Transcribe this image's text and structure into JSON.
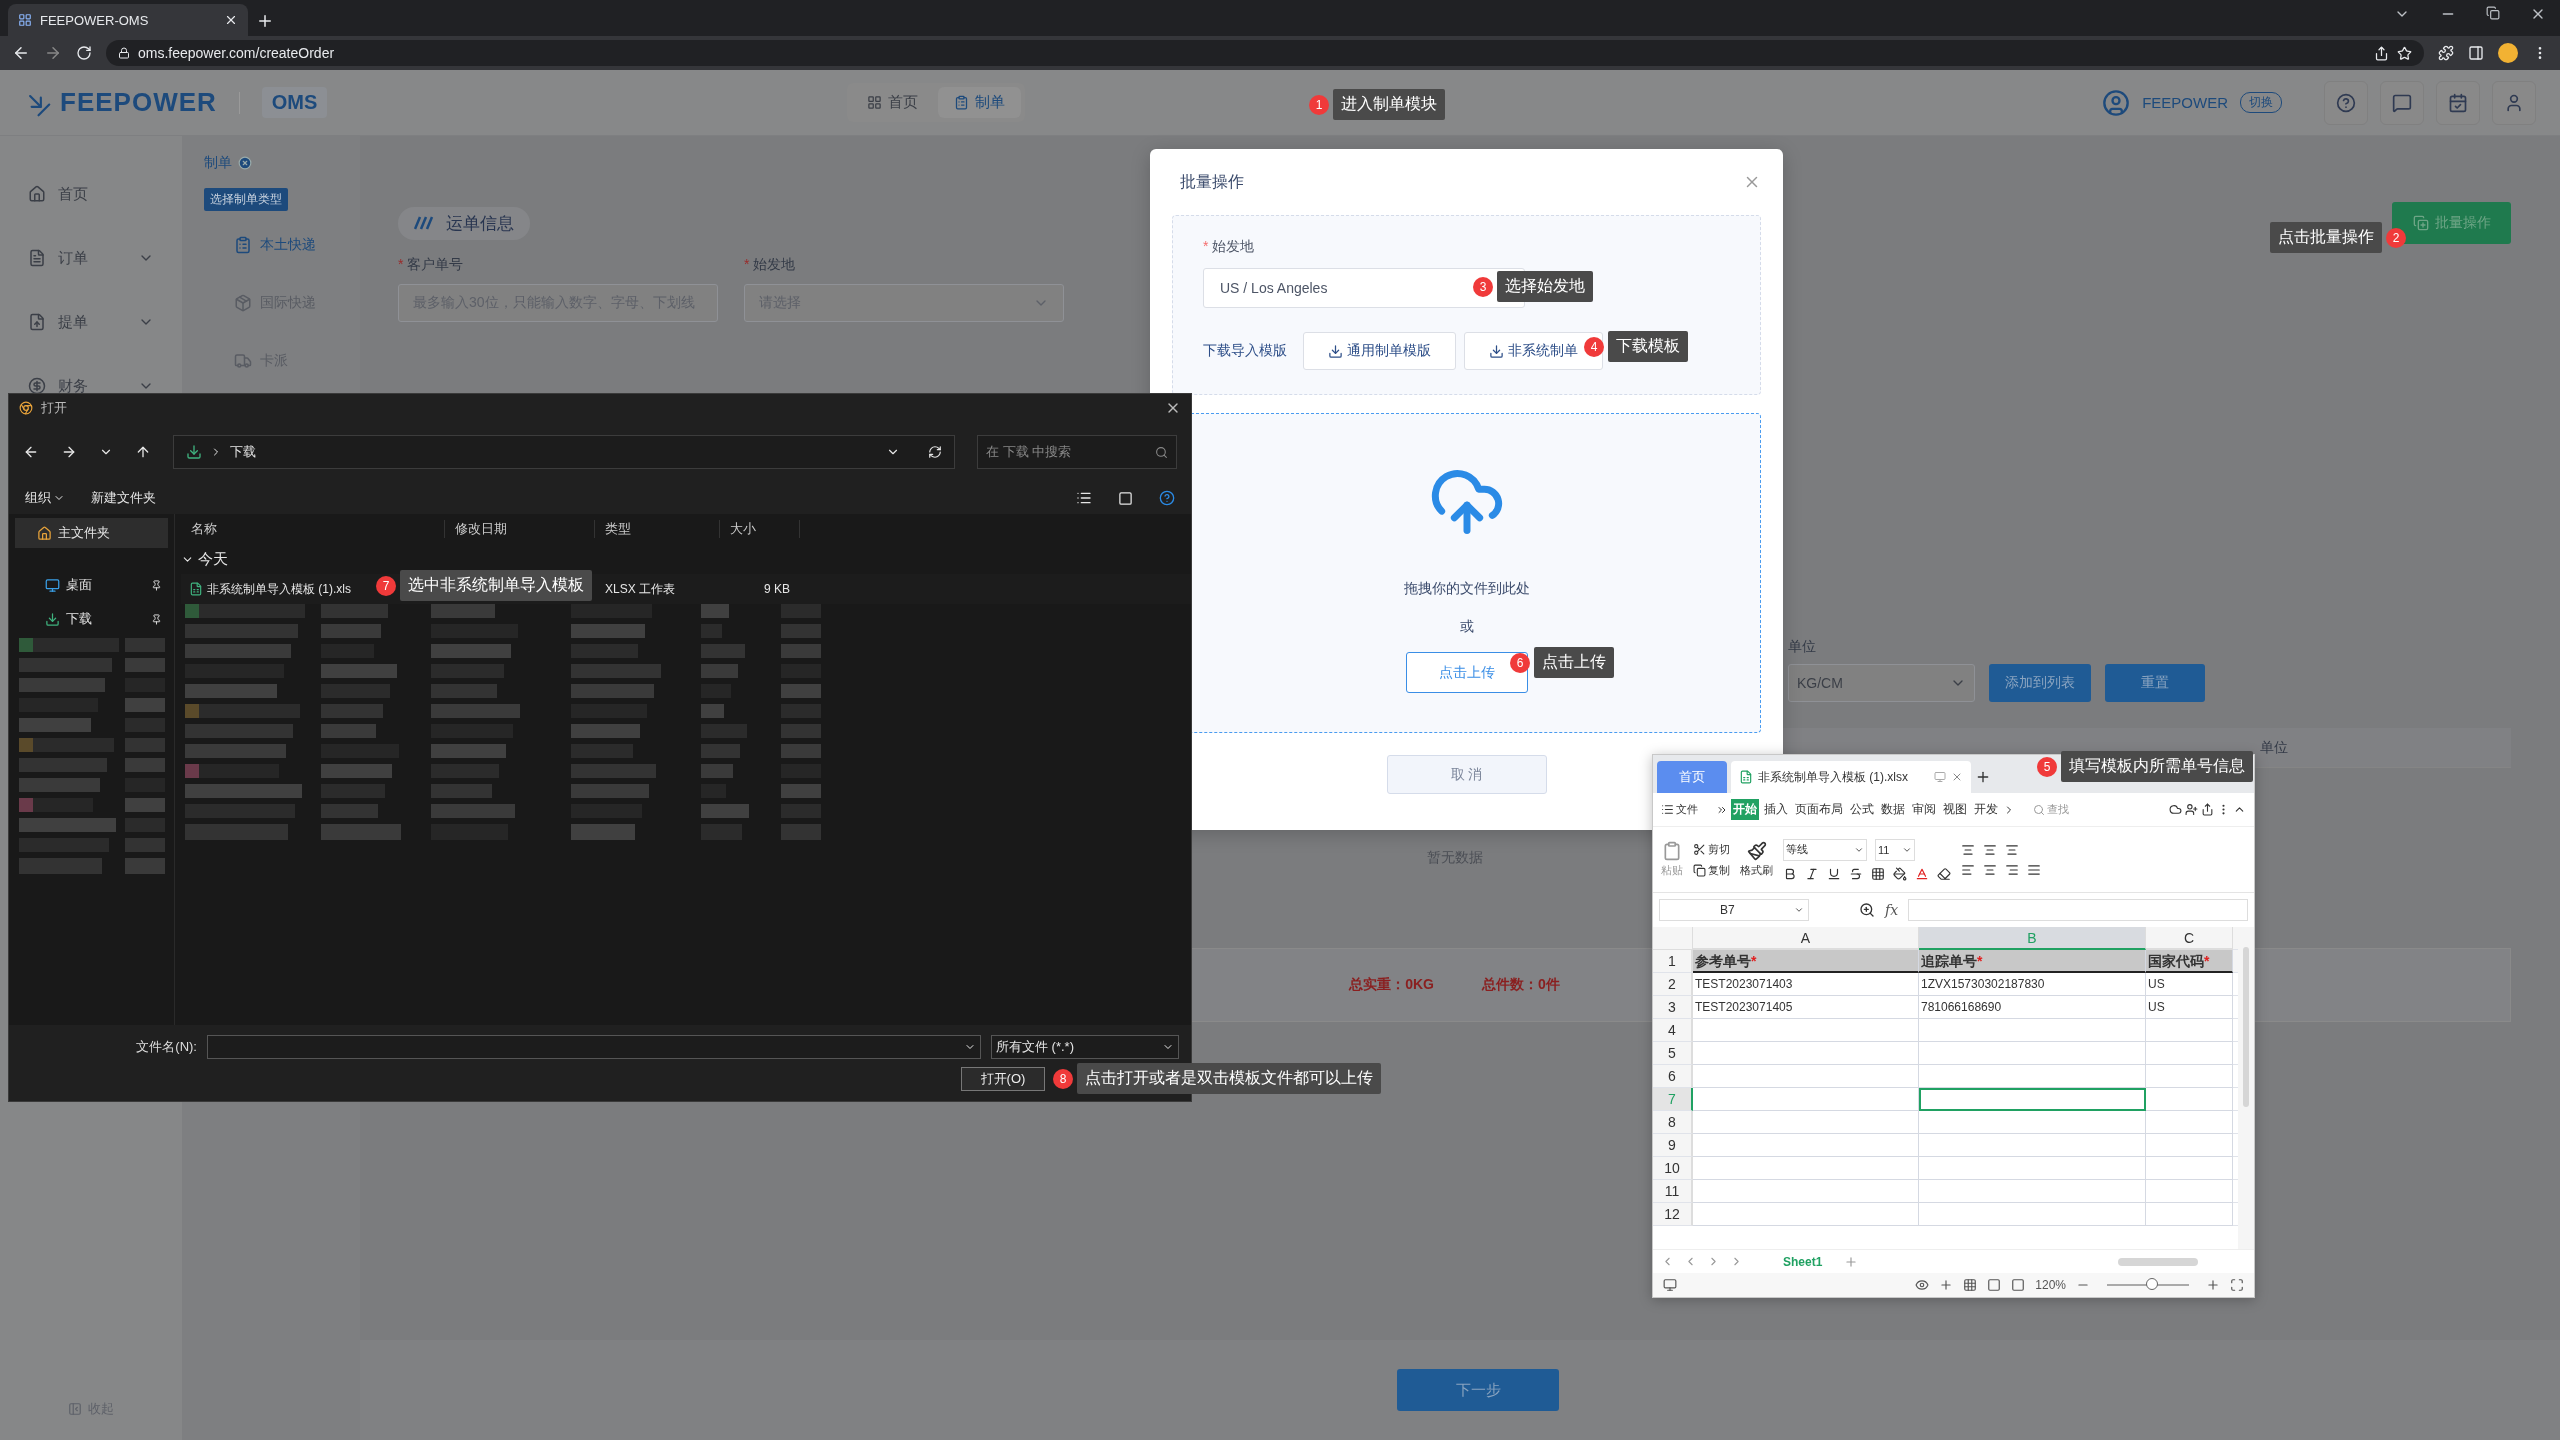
{
  "browser": {
    "tab_title": "FEEPOWER-OMS",
    "url": "oms.feepower.com/createOrder"
  },
  "header": {
    "logo": "FEEPOWER",
    "product": "OMS",
    "account": "FEEPOWER",
    "switch_label": "切换",
    "nav": [
      {
        "label": "首页",
        "selected": false
      },
      {
        "label": "制单",
        "selected": true
      }
    ]
  },
  "sidebar": {
    "items": [
      {
        "label": "首页",
        "expandable": false
      },
      {
        "label": "订单",
        "expandable": true
      },
      {
        "label": "提单",
        "expandable": true
      },
      {
        "label": "财务",
        "expandable": true
      }
    ],
    "collapse_label": "收起"
  },
  "page_tab": "制单",
  "submenu": {
    "title": "选择制单类型",
    "items": [
      {
        "label": "本土快递",
        "selected": true
      },
      {
        "label": "国际快递",
        "selected": false
      },
      {
        "label": "卡派",
        "selected": false
      }
    ]
  },
  "form": {
    "section_title": "运单信息",
    "batch_button": "批量操作",
    "fields": [
      {
        "kind": "input",
        "required_mark": "*",
        "label": "客户单号",
        "placeholder": "最多输入30位，只能输入数字、字母、下划线"
      },
      {
        "kind": "select",
        "required_mark": "*",
        "label": "始发地",
        "placeholder": "请选择"
      }
    ]
  },
  "cargo": {
    "unit_label": "单位",
    "unit_value": "KG/CM",
    "add_button": "添加到列表",
    "reset_button": "重置"
  },
  "table": {
    "column_header": "单位",
    "empty_text": "暂无数据"
  },
  "totals": [
    "总实重：0KG",
    "总件数：0件"
  ],
  "next_button": "下一步",
  "modal": {
    "title": "批量操作",
    "origin": {
      "required_mark": "*",
      "label": "始发地",
      "value": "US / Los Angeles"
    },
    "template_label": "下载导入模版",
    "template_buttons": [
      "通用制单模版",
      "非系统制单"
    ],
    "drop_text": "拖拽你的文件到此处",
    "or_text": "或",
    "upload_button": "点击上传",
    "cancel_button": "取 消"
  },
  "file_dialog": {
    "title": "打开",
    "path": "下载",
    "search_placeholder": "在 下载 中搜索",
    "toolbar": [
      "组织",
      "新建文件夹"
    ],
    "nav_items": [
      {
        "label": "主文件夹",
        "selected": true
      },
      {
        "label": "桌面",
        "selected": false
      },
      {
        "label": "下载",
        "selected": false
      }
    ],
    "columns": [
      "名称",
      "修改日期",
      "类型",
      "大小"
    ],
    "group": "今天",
    "file": {
      "name": "非系统制单导入模板 (1).xls",
      "type": "XLSX 工作表",
      "size": "9 KB"
    },
    "filename_label": "文件名(N):",
    "filetype": "所有文件 (*.*)",
    "open_button": "打开(O)"
  },
  "spreadsheet": {
    "home_tab": "首页",
    "file_tab": "非系统制单导入模板 (1).xlsx",
    "file_menu": "文件",
    "menu": [
      {
        "label": "开始",
        "selected": true
      },
      {
        "label": "插入",
        "selected": false
      },
      {
        "label": "页面布局",
        "selected": false
      },
      {
        "label": "公式",
        "selected": false
      },
      {
        "label": "数据",
        "selected": false
      },
      {
        "label": "审阅",
        "selected": false
      },
      {
        "label": "视图",
        "selected": false
      },
      {
        "label": "开发",
        "selected": false
      }
    ],
    "search_label": "查找",
    "paste": "粘贴",
    "cut": "剪切",
    "copy": "复制",
    "format_painter": "格式刷",
    "font": "等线",
    "font_size": "11",
    "name_box": "B7",
    "fx": "fx",
    "columns": [
      {
        "label": "A",
        "selected": false
      },
      {
        "label": "B",
        "selected": true
      },
      {
        "label": "C",
        "selected": false
      }
    ],
    "rows": [
      {
        "number": "1",
        "kind": "header",
        "selected": false,
        "cells": [
          {
            "text": "参考单号",
            "mark": "*"
          },
          {
            "text": "追踪单号",
            "mark": "*"
          },
          {
            "text": "国家代码",
            "mark": "*"
          }
        ]
      },
      {
        "number": "2",
        "kind": "data",
        "selected": false,
        "cells": [
          {
            "text": "TEST2023071403"
          },
          {
            "text": "1ZVX15730302187830"
          },
          {
            "text": "US"
          }
        ]
      },
      {
        "number": "3",
        "kind": "data",
        "selected": false,
        "cells": [
          {
            "text": "TEST2023071405"
          },
          {
            "text": "781066168690"
          },
          {
            "text": "US"
          }
        ]
      },
      {
        "number": "4",
        "kind": "data",
        "selected": false
      },
      {
        "number": "5",
        "kind": "data",
        "selected": false
      },
      {
        "number": "6",
        "kind": "data",
        "selected": false
      },
      {
        "number": "7",
        "kind": "data",
        "selected": true
      },
      {
        "number": "8",
        "kind": "data",
        "selected": false
      },
      {
        "number": "9",
        "kind": "data",
        "selected": false
      },
      {
        "number": "10",
        "kind": "data",
        "selected": false
      },
      {
        "number": "11",
        "kind": "data",
        "selected": false
      },
      {
        "number": "12",
        "kind": "data",
        "selected": false
      }
    ],
    "sheet_tab": "Sheet1",
    "zoom": "120%",
    "zoom_slider": {
      "level": 0.55
    }
  },
  "callouts": [
    {
      "number": "1",
      "text": "进入制单模块"
    },
    {
      "number": "2",
      "text": "点击批量操作"
    },
    {
      "number": "3",
      "text": "选择始发地"
    },
    {
      "number": "4",
      "text": "下载模板"
    },
    {
      "number": "5",
      "text": "填写模板内所需单号信息"
    },
    {
      "number": "6",
      "text": "点击上传"
    },
    {
      "number": "7",
      "text": "选中非系统制单导入模板"
    },
    {
      "number": "8",
      "text": "点击打开或者是双击模板文件都可以上传"
    }
  ]
}
